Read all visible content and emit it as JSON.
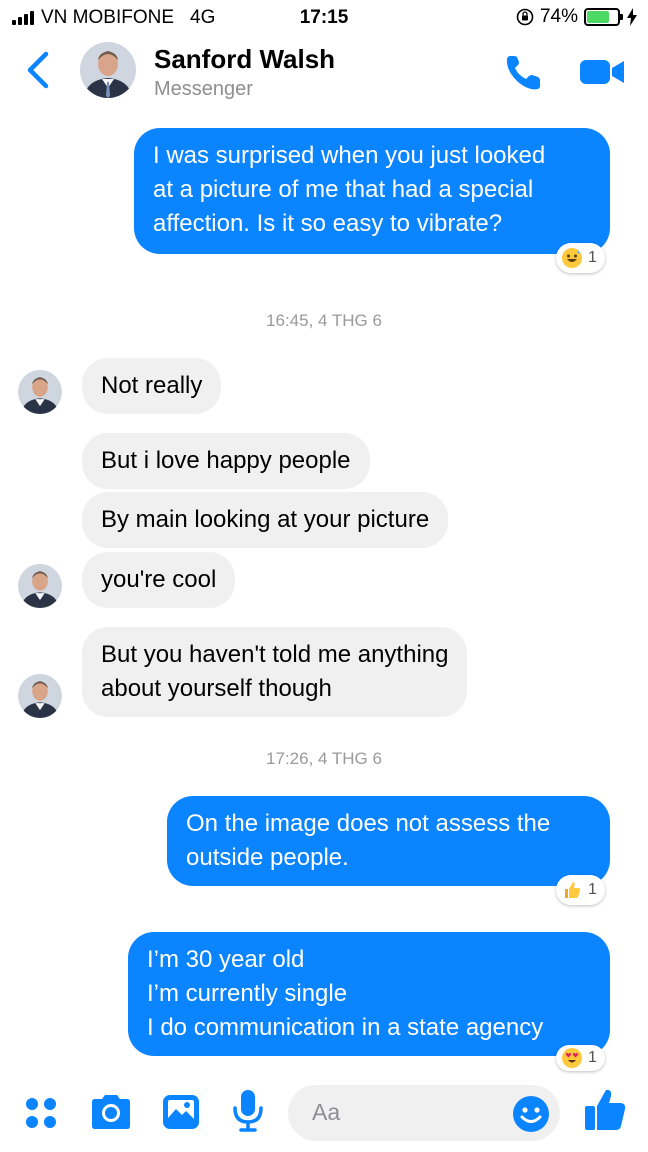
{
  "status_bar": {
    "carrier": "VN MOBIFONE",
    "network": "4G",
    "time": "17:15",
    "battery_text": "74%",
    "battery_level": 0.74
  },
  "header": {
    "contact_name": "Sanford Walsh",
    "subtitle": "Messenger",
    "accent_color": "#0a84ff"
  },
  "messages": [
    {
      "id": "m1",
      "direction": "outgoing",
      "lines": [
        "I was surprised when you just looked",
        "at a picture of me that had a special",
        "affection. Is it so easy to vibrate?"
      ],
      "reaction": {
        "icon": "grinning-sweat-emoji",
        "count": "1"
      }
    },
    {
      "id": "t1",
      "type": "timestamp",
      "text": "16:45, 4 THG 6"
    },
    {
      "id": "m2",
      "direction": "incoming",
      "lines": [
        "Not really"
      ]
    },
    {
      "id": "m3",
      "direction": "incoming",
      "lines": [
        "But i love happy people"
      ]
    },
    {
      "id": "m4",
      "direction": "incoming",
      "lines": [
        "By main looking at your picture"
      ]
    },
    {
      "id": "m5",
      "direction": "incoming",
      "lines": [
        "you're cool"
      ]
    },
    {
      "id": "m6",
      "direction": "incoming",
      "lines": [
        "But you haven't told me anything",
        "about yourself though"
      ]
    },
    {
      "id": "t2",
      "type": "timestamp",
      "text": "17:26, 4 THG 6"
    },
    {
      "id": "m7",
      "direction": "outgoing",
      "lines": [
        "On the image does not assess the",
        "outside people."
      ],
      "reaction": {
        "icon": "thumbs-up-emoji",
        "count": "1"
      }
    },
    {
      "id": "m8",
      "direction": "outgoing",
      "lines": [
        "I’m 30 year old",
        "I’m currently single",
        "I do communication in a state agency"
      ],
      "reaction": {
        "icon": "heart-eyes-emoji",
        "count": "1"
      }
    }
  ],
  "composer": {
    "placeholder": "Aa",
    "icons": [
      "menu-dots-icon",
      "camera-icon",
      "gallery-icon",
      "microphone-icon",
      "emoji-icon",
      "like-icon"
    ]
  }
}
